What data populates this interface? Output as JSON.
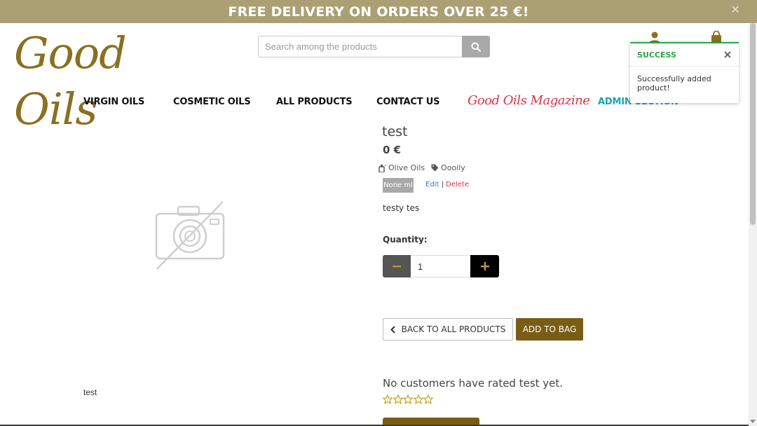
{
  "banner": {
    "text": "FREE DELIVERY ON ORDERS OVER 25 €!",
    "close_label": "✕"
  },
  "logo": {
    "text": "Good Oils"
  },
  "search": {
    "placeholder": "Search among the products",
    "icon": "search-icon"
  },
  "header_icons": [
    "user-icon",
    "shopping-bag-icon"
  ],
  "nav": {
    "virgin_oils": "VIRGIN OILS",
    "cosmetic_oils": "COSMETIC OILS",
    "all_products": "ALL PRODUCTS",
    "contact_us": "CONTACT US",
    "magazine": "Good Oils Magazine",
    "admin": "ADMIN SECTION"
  },
  "toast": {
    "title": "SUCCESS",
    "message": "Successfully added product!",
    "close_icon": "close-icon"
  },
  "product": {
    "image_icon": "no-image-camera-icon",
    "caption": "test",
    "name": "test",
    "price": "0 €",
    "category": "Olive Oils",
    "tag": "Oooily",
    "size": "None ml",
    "edit_label": "Edit",
    "separator": "|",
    "delete_label": "Delete",
    "description": "testy tes",
    "quantity_label": "Quantity:",
    "quantity_value": "1"
  },
  "actions": {
    "back_label": "BACK TO ALL PRODUCTS",
    "add_label": "ADD TO BAG"
  },
  "rating": {
    "text": "No customers have rated test yet.",
    "stars_total": 5,
    "stars_filled": 0
  },
  "colors": {
    "banner": "#ab9f74",
    "brand_gold": "#8a7020",
    "add_button": "#7a5d14",
    "success": "#28a745",
    "magazine": "#d8344a",
    "admin": "#1ea1b8",
    "star": "#c9a227"
  }
}
